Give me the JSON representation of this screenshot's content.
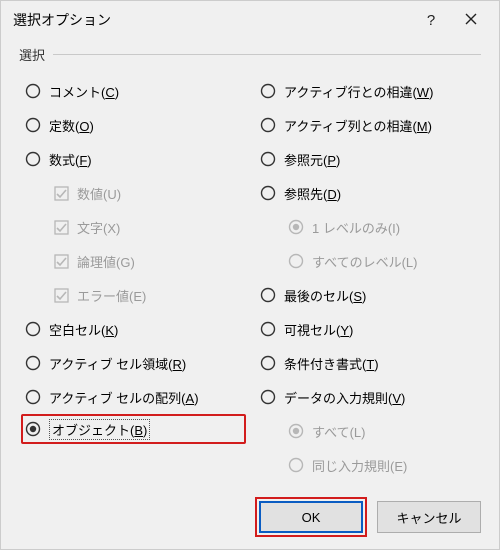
{
  "title": "選択オプション",
  "group_label": "選択",
  "left": {
    "comments": {
      "text": "コメント(",
      "accel": "C",
      "tail": ")"
    },
    "constants": {
      "text": "定数(",
      "accel": "O",
      "tail": ")"
    },
    "formulas": {
      "text": "数式(",
      "accel": "F",
      "tail": ")"
    },
    "numbers": {
      "text": "数値(U)"
    },
    "texts": {
      "text": "文字(X)"
    },
    "logicals": {
      "text": "論理値(G)"
    },
    "errors": {
      "text": "エラー値(E)"
    },
    "blanks": {
      "text": "空白セル(",
      "accel": "K",
      "tail": ")"
    },
    "region": {
      "text": "アクティブ セル領域(",
      "accel": "R",
      "tail": ")"
    },
    "array": {
      "text": "アクティブ セルの配列(",
      "accel": "A",
      "tail": ")"
    },
    "objects": {
      "text": "オブジェクト(",
      "accel": "B",
      "tail": ")"
    }
  },
  "right": {
    "rowdiff": {
      "text": "アクティブ行との相違(",
      "accel": "W",
      "tail": ")"
    },
    "coldiff": {
      "text": "アクティブ列との相違(",
      "accel": "M",
      "tail": ")"
    },
    "precedents": {
      "text": "参照元(",
      "accel": "P",
      "tail": ")"
    },
    "dependents": {
      "text": "参照先(",
      "accel": "D",
      "tail": ")"
    },
    "one_level": {
      "text": "1 レベルのみ(I)"
    },
    "all_levels": {
      "text": "すべてのレベル(L)"
    },
    "lastcell": {
      "text": "最後のセル(",
      "accel": "S",
      "tail": ")"
    },
    "visible": {
      "text": "可視セル(",
      "accel": "Y",
      "tail": ")"
    },
    "condfmt": {
      "text": "条件付き書式(",
      "accel": "T",
      "tail": ")"
    },
    "validation": {
      "text": "データの入力規則(",
      "accel": "V",
      "tail": ")"
    },
    "all": {
      "text": "すべて(L)"
    },
    "same": {
      "text": "同じ入力規則(E)"
    }
  },
  "buttons": {
    "ok": "OK",
    "cancel": "キャンセル"
  }
}
